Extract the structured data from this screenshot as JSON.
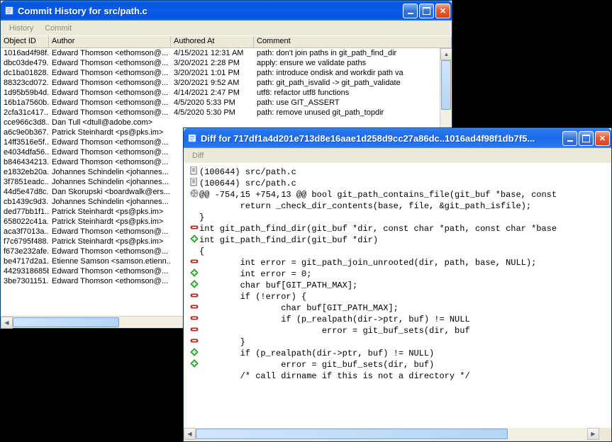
{
  "window1": {
    "title": "Commit History for src/path.c",
    "menu": [
      "History",
      "Commit"
    ],
    "columns": [
      "Object ID",
      "Author",
      "Authored At",
      "Comment"
    ],
    "rows": [
      {
        "id": "1016ad4f98f...",
        "author": "Edward Thomson <ethomson@...",
        "at": "4/15/2021 12:31 AM",
        "comment": "path: don't join paths in git_path_find_dir"
      },
      {
        "id": "dbc03de479...",
        "author": "Edward Thomson <ethomson@...",
        "at": "3/20/2021 2:28 PM",
        "comment": "apply: ensure we validate paths"
      },
      {
        "id": "dc1ba01828...",
        "author": "Edward Thomson <ethomson@...",
        "at": "3/20/2021 1:01 PM",
        "comment": "path: introduce ondisk and workdir path va"
      },
      {
        "id": "88323cd072...",
        "author": "Edward Thomson <ethomson@...",
        "at": "3/20/2021 9:52 AM",
        "comment": "path: git_path_isvalid -> git_path_validate"
      },
      {
        "id": "1d95b59b4d...",
        "author": "Edward Thomson <ethomson@...",
        "at": "4/14/2021 2:47 PM",
        "comment": "utf8: refactor utf8 functions"
      },
      {
        "id": "16b1a7560b...",
        "author": "Edward Thomson <ethomson@...",
        "at": "4/5/2020 5:33 PM",
        "comment": "path: use GIT_ASSERT"
      },
      {
        "id": "2cfa31c417...",
        "author": "Edward Thomson <ethomson@...",
        "at": "4/5/2020 5:30 PM",
        "comment": "path: remove unused git_path_topdir"
      },
      {
        "id": "cce966c3d8...",
        "author": "Dan Tull <dtull@adobe.com>",
        "at": "",
        "comment": ""
      },
      {
        "id": "a6c9e0b367...",
        "author": "Patrick Steinhardt <ps@pks.im>",
        "at": "",
        "comment": ""
      },
      {
        "id": "14ff3516e5f...",
        "author": "Edward Thomson <ethomson@...",
        "at": "",
        "comment": ""
      },
      {
        "id": "e4034dfa56...",
        "author": "Edward Thomson <ethomson@...",
        "at": "",
        "comment": ""
      },
      {
        "id": "b846434213...",
        "author": "Edward Thomson <ethomson@...",
        "at": "",
        "comment": ""
      },
      {
        "id": "e1832eb20a...",
        "author": "Johannes Schindelin <johannes...",
        "at": "",
        "comment": ""
      },
      {
        "id": "3f7851eadc...",
        "author": "Johannes Schindelin <johannes...",
        "at": "",
        "comment": ""
      },
      {
        "id": "44d5e47d8c...",
        "author": "Dan Skorupski <boardwalk@ers...",
        "at": "",
        "comment": ""
      },
      {
        "id": "cb1439c9d3...",
        "author": "Johannes Schindelin <johannes...",
        "at": "",
        "comment": ""
      },
      {
        "id": "ded77bb1f1...",
        "author": "Patrick Steinhardt <ps@pks.im>",
        "at": "",
        "comment": ""
      },
      {
        "id": "658022c41a...",
        "author": "Patrick Steinhardt <ps@pks.im>",
        "at": "",
        "comment": ""
      },
      {
        "id": "aca3f7013a...",
        "author": "Edward Thomson <ethomson@...",
        "at": "",
        "comment": ""
      },
      {
        "id": "f7c6795f488...",
        "author": "Patrick Steinhardt <ps@pks.im>",
        "at": "",
        "comment": ""
      },
      {
        "id": "f673e232afe...",
        "author": "Edward Thomson <ethomson@...",
        "at": "",
        "comment": ""
      },
      {
        "id": "be4717d2a1...",
        "author": "Etienne Samson <samson.etienn...",
        "at": "",
        "comment": ""
      },
      {
        "id": "4429318685b...",
        "author": "Edward Thomson <ethomson@...",
        "at": "",
        "comment": ""
      },
      {
        "id": "3be7301151...",
        "author": "Edward Thomson <ethomson@...",
        "at": "",
        "comment": ""
      }
    ]
  },
  "window2": {
    "title": "Diff for 717df1a4d201e713d8e16aae1d258d9cc27a86dc..1016ad4f98f1db7f5...",
    "menu": [
      "Diff"
    ],
    "lines": [
      {
        "t": "file",
        "text": "(100644) src/path.c"
      },
      {
        "t": "file",
        "text": "(100644) src/path.c"
      },
      {
        "t": "hunk",
        "text": "@@ -754,15 +754,13 @@ bool git_path_contains_file(git_buf *base, const"
      },
      {
        "t": "ctx",
        "text": "\treturn _check_dir_contents(base, file, &git_path_isfile);"
      },
      {
        "t": "ctx",
        "text": "}"
      },
      {
        "t": "blank",
        "text": ""
      },
      {
        "t": "del",
        "text": "int git_path_find_dir(git_buf *dir, const char *path, const char *base"
      },
      {
        "t": "add",
        "text": "int git_path_find_dir(git_buf *dir)"
      },
      {
        "t": "ctx",
        "text": "{"
      },
      {
        "t": "del",
        "text": "\tint error = git_path_join_unrooted(dir, path, base, NULL);"
      },
      {
        "t": "add",
        "text": "\tint error = 0;"
      },
      {
        "t": "add",
        "text": "\tchar buf[GIT_PATH_MAX];"
      },
      {
        "t": "blank",
        "text": ""
      },
      {
        "t": "del",
        "text": "\tif (!error) {"
      },
      {
        "t": "del",
        "text": "\t\tchar buf[GIT_PATH_MAX];"
      },
      {
        "t": "del",
        "text": "\t\tif (p_realpath(dir->ptr, buf) != NULL"
      },
      {
        "t": "del",
        "text": "\t\t\terror = git_buf_sets(dir, buf"
      },
      {
        "t": "del",
        "text": "\t}"
      },
      {
        "t": "add",
        "text": "\tif (p_realpath(dir->ptr, buf) != NULL)"
      },
      {
        "t": "add",
        "text": "\t\terror = git_buf_sets(dir, buf)"
      },
      {
        "t": "blank",
        "text": ""
      },
      {
        "t": "ctx",
        "text": "\t/* call dirname if this is not a directory */"
      }
    ]
  }
}
